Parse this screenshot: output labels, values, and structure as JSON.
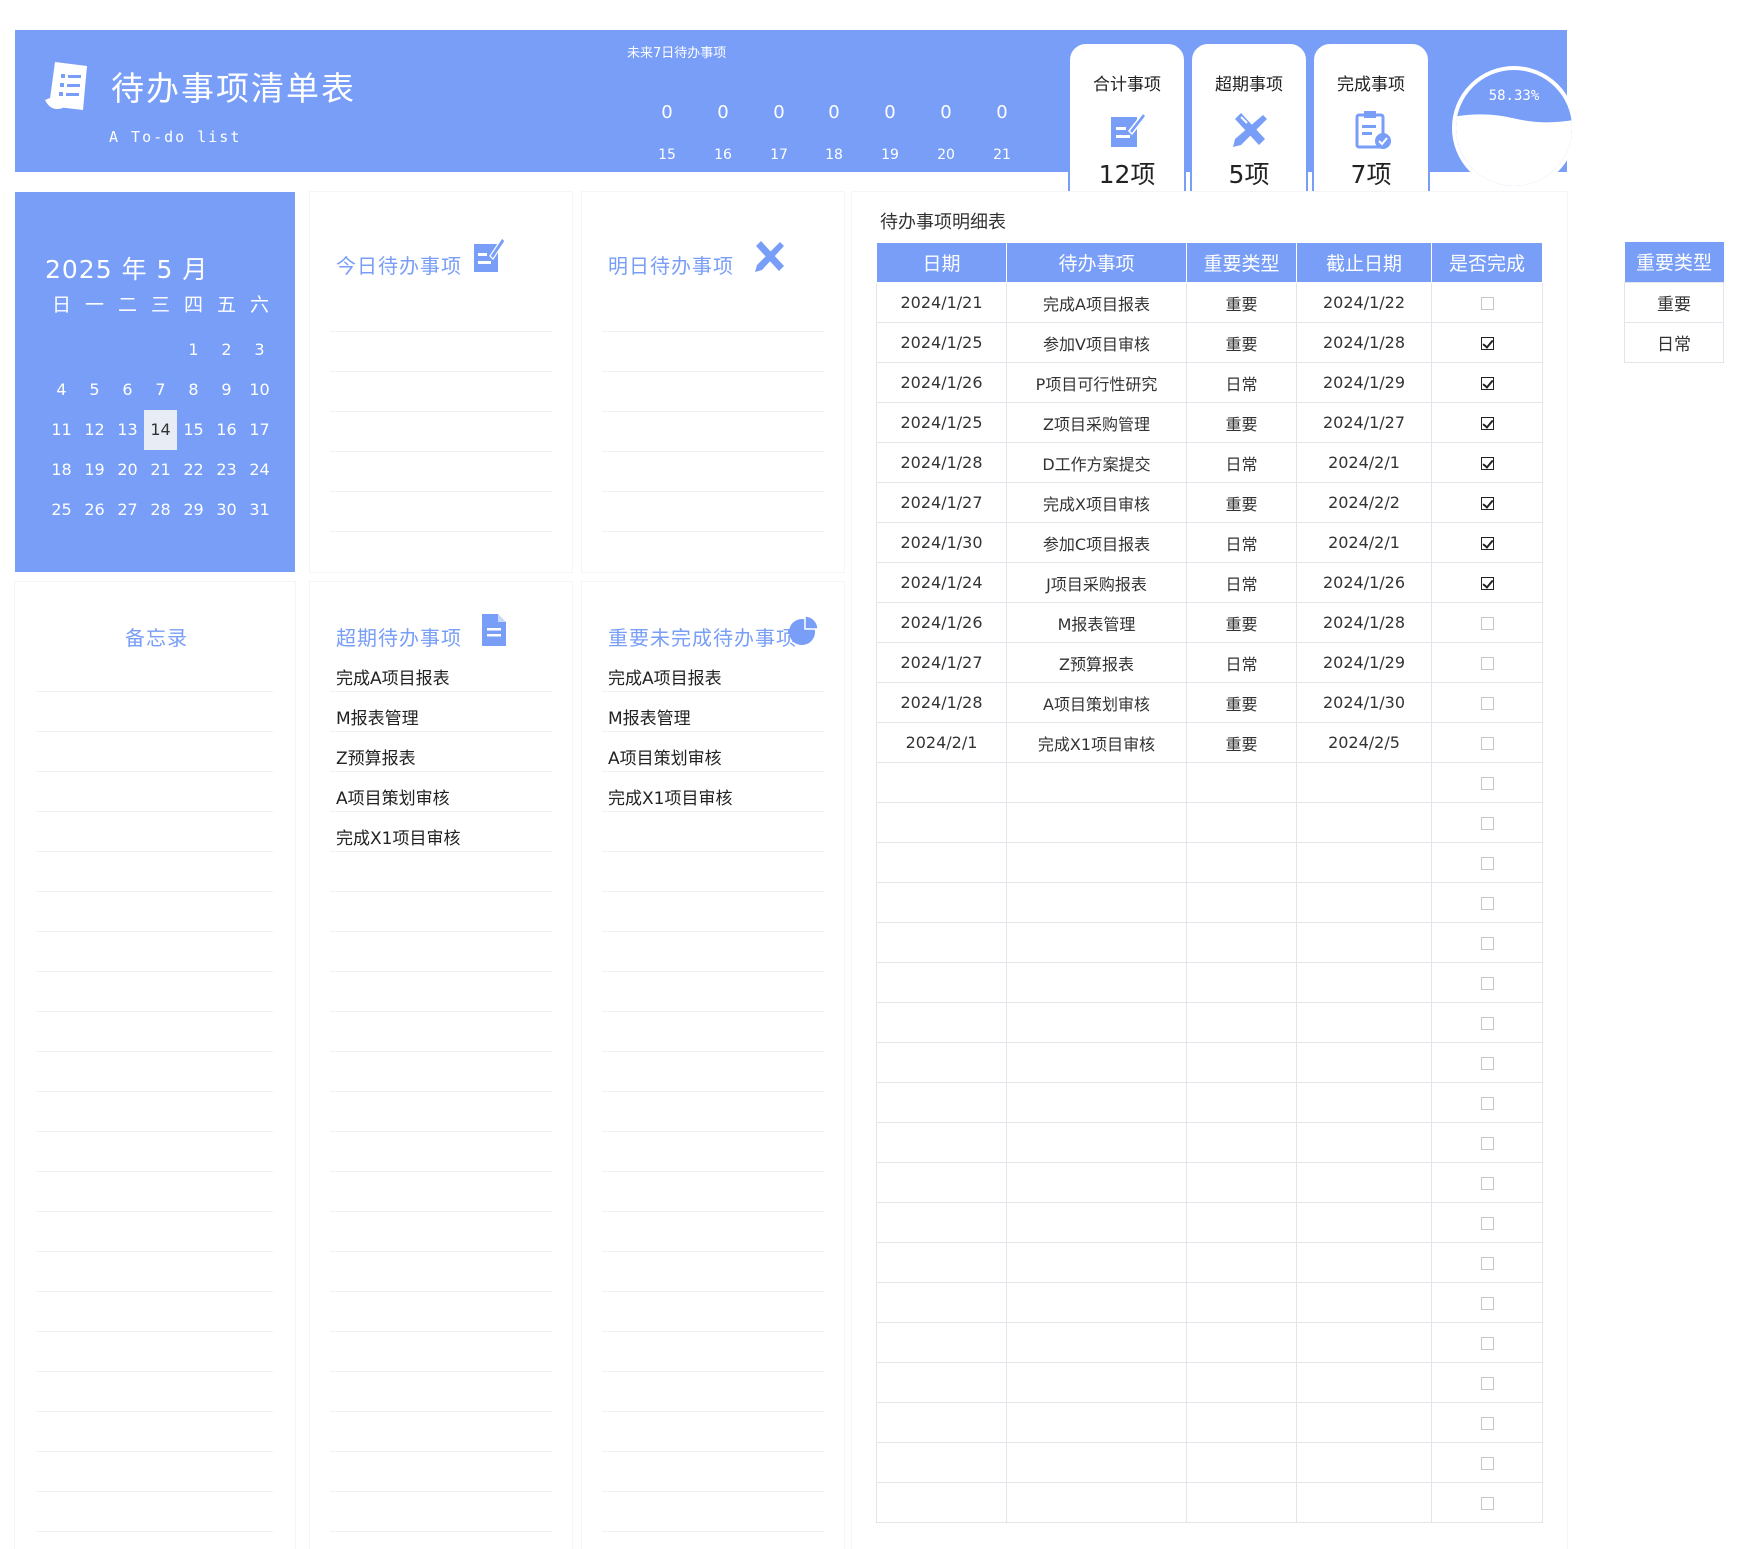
{
  "header": {
    "title": "待办事项清单表",
    "subtitle": "A To-do list",
    "next7_label": "未来7日待办事项",
    "next7": [
      {
        "day": "15",
        "count": "0"
      },
      {
        "day": "16",
        "count": "0"
      },
      {
        "day": "17",
        "count": "0"
      },
      {
        "day": "18",
        "count": "0"
      },
      {
        "day": "19",
        "count": "0"
      },
      {
        "day": "20",
        "count": "0"
      },
      {
        "day": "21",
        "count": "0"
      }
    ]
  },
  "stats": {
    "total": {
      "label": "合计事项",
      "value": "12项"
    },
    "overdue": {
      "label": "超期事项",
      "value": "5项"
    },
    "done": {
      "label": "完成事项",
      "value": "7项"
    },
    "completion_rate": {
      "text": "58.33%",
      "fraction": 0.5833
    }
  },
  "calendar": {
    "title": "2025 年 5 月",
    "weekdays": [
      "日",
      "一",
      "二",
      "三",
      "四",
      "五",
      "六"
    ],
    "today": "14",
    "weeks": [
      [
        "",
        "",
        "",
        "",
        "1",
        "2",
        "3"
      ],
      [
        "4",
        "5",
        "6",
        "7",
        "8",
        "9",
        "10"
      ],
      [
        "11",
        "12",
        "13",
        "14",
        "15",
        "16",
        "17"
      ],
      [
        "18",
        "19",
        "20",
        "21",
        "22",
        "23",
        "24"
      ],
      [
        "25",
        "26",
        "27",
        "28",
        "29",
        "30",
        "31"
      ]
    ]
  },
  "panels": {
    "today": {
      "title": "今日待办事项",
      "items": []
    },
    "tomorrow": {
      "title": "明日待办事项",
      "items": []
    },
    "memo": {
      "title": "备忘录",
      "items": []
    },
    "overdue": {
      "title": "超期待办事项",
      "items": [
        "完成A项目报表",
        "M报表管理",
        "Z预算报表",
        "A项目策划审核",
        "完成X1项目审核"
      ]
    },
    "important": {
      "title": "重要未完成待办事项",
      "items": [
        "完成A项目报表",
        "M报表管理",
        "A项目策划审核",
        "完成X1项目审核"
      ]
    }
  },
  "detail": {
    "title": "待办事项明细表",
    "columns": [
      "日期",
      "待办事项",
      "重要类型",
      "截止日期",
      "是否完成"
    ],
    "rows": [
      {
        "date": "2024/1/21",
        "task": "完成A项目报表",
        "type": "重要",
        "deadline": "2024/1/22",
        "done": false
      },
      {
        "date": "2024/1/25",
        "task": "参加V项目审核",
        "type": "重要",
        "deadline": "2024/1/28",
        "done": true
      },
      {
        "date": "2024/1/26",
        "task": "P项目可行性研究",
        "type": "日常",
        "deadline": "2024/1/29",
        "done": true
      },
      {
        "date": "2024/1/25",
        "task": "Z项目采购管理",
        "type": "重要",
        "deadline": "2024/1/27",
        "done": true
      },
      {
        "date": "2024/1/28",
        "task": "D工作方案提交",
        "type": "日常",
        "deadline": "2024/2/1",
        "done": true
      },
      {
        "date": "2024/1/27",
        "task": "完成X项目审核",
        "type": "重要",
        "deadline": "2024/2/2",
        "done": true
      },
      {
        "date": "2024/1/30",
        "task": "参加C项目报表",
        "type": "日常",
        "deadline": "2024/2/1",
        "done": true
      },
      {
        "date": "2024/1/24",
        "task": "J项目采购报表",
        "type": "日常",
        "deadline": "2024/1/26",
        "done": true
      },
      {
        "date": "2024/1/26",
        "task": "M报表管理",
        "type": "重要",
        "deadline": "2024/1/28",
        "done": false
      },
      {
        "date": "2024/1/27",
        "task": "Z预算报表",
        "type": "日常",
        "deadline": "2024/1/29",
        "done": false
      },
      {
        "date": "2024/1/28",
        "task": "A项目策划审核",
        "type": "重要",
        "deadline": "2024/1/30",
        "done": false
      },
      {
        "date": "2024/2/1",
        "task": "完成X1项目审核",
        "type": "重要",
        "deadline": "2024/2/5",
        "done": false
      }
    ],
    "empty_rows": 19
  },
  "type_list": {
    "header": "重要类型",
    "items": [
      "重要",
      "日常"
    ]
  },
  "colors": {
    "accent": "#789ef8",
    "check": "#222222"
  },
  "icons": {
    "logo": "document-list-icon",
    "total": "note-pencil-icon",
    "overdue": "tools-cross-icon",
    "done": "clipboard-check-icon",
    "today": "note-pencil-icon",
    "tomorrow": "tools-cross-icon",
    "overdue_panel": "document-icon",
    "important": "pie-chart-icon"
  }
}
